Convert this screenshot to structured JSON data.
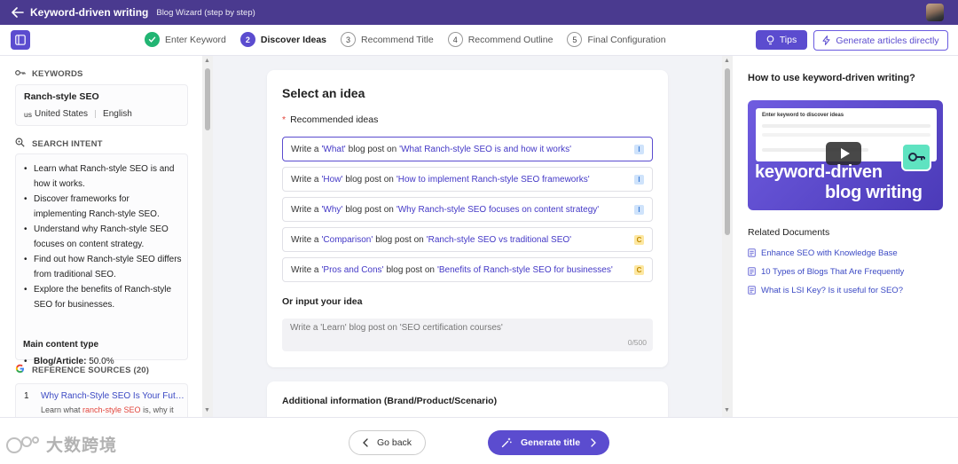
{
  "header": {
    "title": "Keyword-driven writing",
    "subtitle": "Blog Wizard (step by step)"
  },
  "steps": [
    {
      "num": "1",
      "label": "Enter Keyword",
      "state": "done"
    },
    {
      "num": "2",
      "label": "Discover Ideas",
      "state": "active"
    },
    {
      "num": "3",
      "label": "Recommend Title",
      "state": "todo"
    },
    {
      "num": "4",
      "label": "Recommend Outline",
      "state": "todo"
    },
    {
      "num": "5",
      "label": "Final Configuration",
      "state": "todo"
    }
  ],
  "toolbar": {
    "tips_label": "Tips",
    "generate_direct_label": "Generate articles directly"
  },
  "sidebar": {
    "keywords_heading": "KEYWORDS",
    "keyword": "Ranch-style SEO",
    "country_code": "us",
    "country": "United States",
    "language": "English",
    "intent_heading": "SEARCH INTENT",
    "intents": [
      "Learn what Ranch-style SEO is and how it works.",
      "Discover frameworks for implementing Ranch-style SEO.",
      "Understand why Ranch-style SEO focuses on content strategy.",
      "Find out how Ranch-style SEO differs from traditional SEO.",
      "Explore the benefits of Ranch-style SEO for businesses."
    ],
    "main_type_title": "Main content type",
    "main_type_label": "Blog/Article:",
    "main_type_value": "50.0%",
    "ref_heading": "REFERENCE SOURCES (20)",
    "ref_num": "1",
    "ref_title": "Why Ranch-Style SEO Is Your Future-...",
    "ref_snippet_pre": "Learn what ",
    "ref_snippet_hl": "ranch-style SEO",
    "ref_snippet_post": " is, why it"
  },
  "main": {
    "panel_title": "Select an idea",
    "required_mark": "*",
    "recommended_label": "Recommended ideas",
    "ideas": [
      {
        "pre": "Write a",
        "type": "'What'",
        "mid": "blog post on",
        "topic": "'What Ranch-style SEO is and how it works'",
        "badge": "I"
      },
      {
        "pre": "Write a",
        "type": "'How'",
        "mid": "blog post on",
        "topic": "'How to implement Ranch-style SEO frameworks'",
        "badge": "I"
      },
      {
        "pre": "Write a",
        "type": "'Why'",
        "mid": "blog post on",
        "topic": "'Why Ranch-style SEO focuses on content strategy'",
        "badge": "I"
      },
      {
        "pre": "Write a",
        "type": "'Comparison'",
        "mid": "blog post on",
        "topic": "'Ranch-style SEO vs traditional SEO'",
        "badge": "C"
      },
      {
        "pre": "Write a",
        "type": "'Pros and Cons'",
        "mid": "blog post on",
        "topic": "'Benefits of Ranch-style SEO for businesses'",
        "badge": "C"
      }
    ],
    "input_label": "Or input your idea",
    "input_placeholder": "Write a 'Learn' blog post on 'SEO certification courses'",
    "char_count": "0/500",
    "additional_title": "Additional information (Brand/Product/Scenario)"
  },
  "right": {
    "title": "How to use keyword-driven writing?",
    "video_caption_line1": "keyword-driven",
    "video_caption_line2": "blog writing",
    "video_inner_title": "Enter keyword to discover ideas",
    "related_title": "Related Documents",
    "docs": [
      "Enhance SEO with Knowledge Base",
      "10 Types of Blogs That Are Frequently",
      "What is LSI Key? Is it useful for SEO?"
    ]
  },
  "footer": {
    "go_back_label": "Go back",
    "generate_title_label": "Generate title",
    "watermark_text": "大数跨境"
  },
  "colors": {
    "header_bg": "#4a3a8f",
    "accent": "#5b4ccf",
    "done_green": "#22b573",
    "link": "#3b49c4"
  }
}
